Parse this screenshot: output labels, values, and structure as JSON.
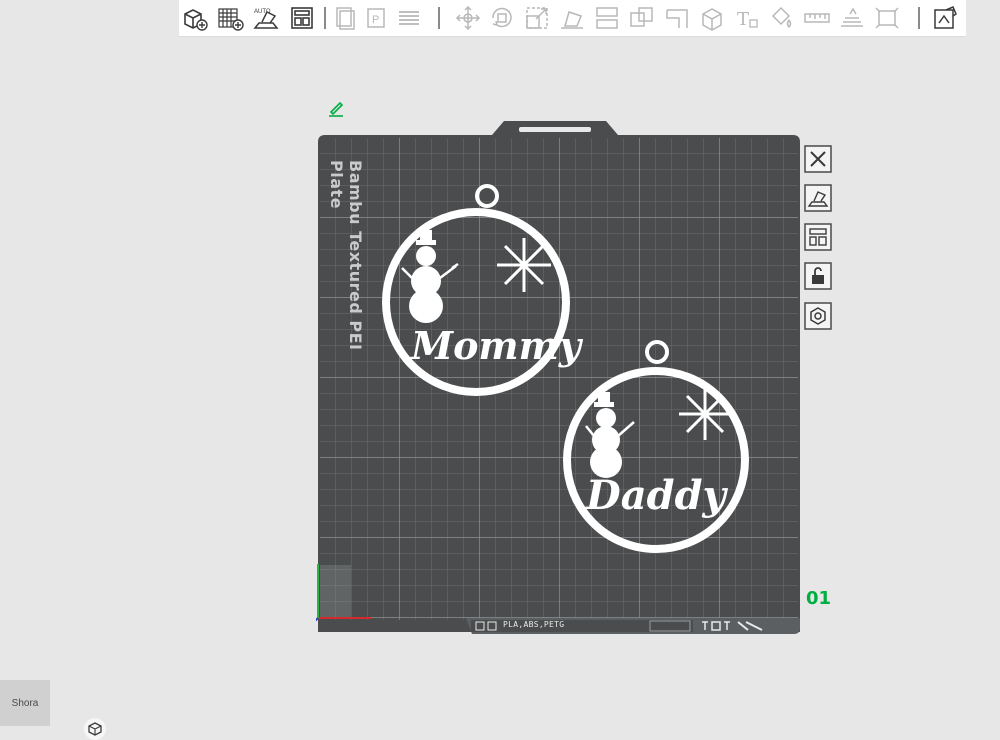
{
  "toolbar": {
    "items": [
      {
        "name": "add-object-icon"
      },
      {
        "name": "add-plate-icon"
      },
      {
        "name": "auto-orient-icon",
        "label": "AUTO"
      },
      {
        "name": "arrange-icon"
      },
      {
        "name": "split-objects-icon"
      },
      {
        "name": "split-parts-icon"
      },
      {
        "name": "layers-icon"
      },
      {
        "name": "move-icon"
      },
      {
        "name": "rotate-icon"
      },
      {
        "name": "scale-icon"
      },
      {
        "name": "lay-on-face-icon"
      },
      {
        "name": "cut-icon"
      },
      {
        "name": "boolean-icon"
      },
      {
        "name": "support-paint-icon"
      },
      {
        "name": "seam-paint-icon"
      },
      {
        "name": "text-icon"
      },
      {
        "name": "color-paint-icon"
      },
      {
        "name": "measure-icon"
      },
      {
        "name": "assembly-icon"
      },
      {
        "name": "variable-layer-icon"
      },
      {
        "name": "view-3d-icon"
      }
    ]
  },
  "plate": {
    "name": "Bambu Textured PEI Plate",
    "index": "01",
    "status_text": "PLA,ABS,PETG"
  },
  "objects": [
    {
      "name": "ornament-mommy",
      "text": "Mommy"
    },
    {
      "name": "ornament-daddy",
      "text": "Daddy"
    }
  ],
  "side_buttons": [
    {
      "name": "close-plate-icon"
    },
    {
      "name": "auto-orient-plate-icon"
    },
    {
      "name": "arrange-plate-icon"
    },
    {
      "name": "lock-icon"
    },
    {
      "name": "plate-settings-icon"
    }
  ],
  "bottom_left": {
    "tile_label": "Shora"
  },
  "colors": {
    "bed": "#4a4c4d",
    "grid": "#7b7e80",
    "accent": "#00ae42",
    "object": "#ffffff"
  }
}
